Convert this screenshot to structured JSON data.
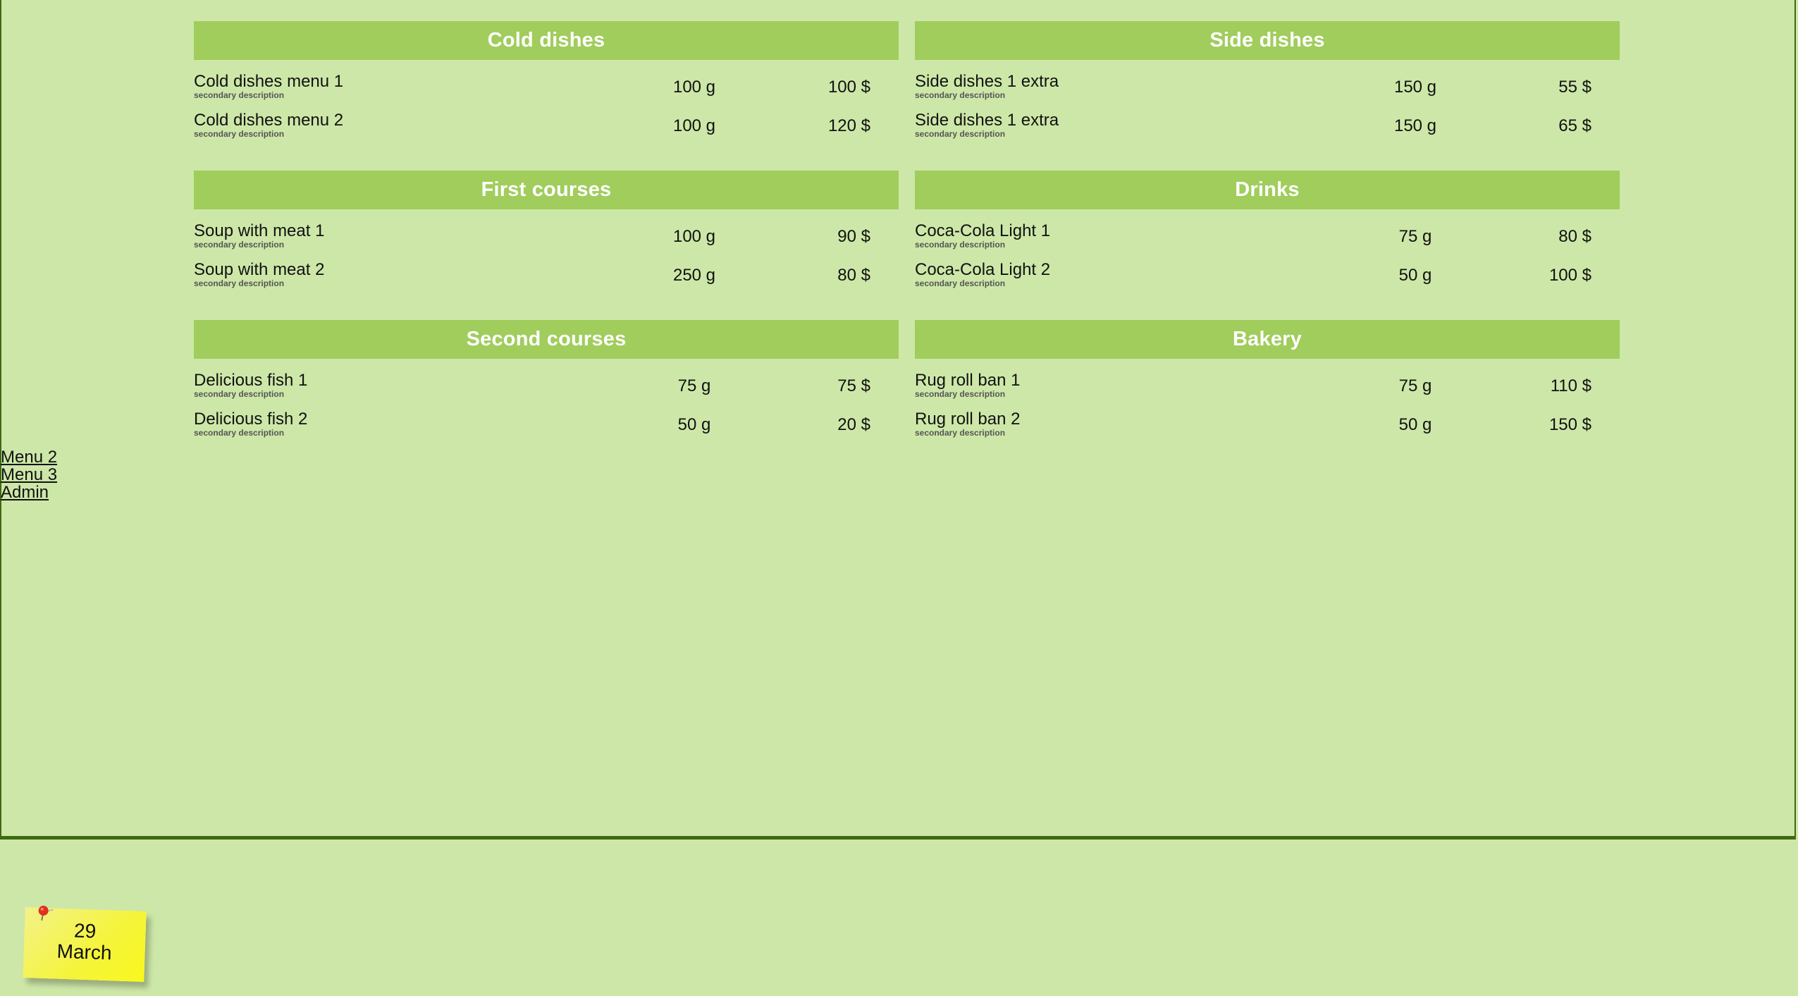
{
  "sections": [
    {
      "title": "Cold dishes",
      "items": [
        {
          "name": "Cold dishes menu 1",
          "desc": "secondary description",
          "weight": "100 g",
          "price": "100 $"
        },
        {
          "name": "Cold dishes menu 2",
          "desc": "secondary description",
          "weight": "100 g",
          "price": "120 $"
        }
      ]
    },
    {
      "title": "Side dishes",
      "items": [
        {
          "name": "Side dishes 1 extra",
          "desc": "secondary description",
          "weight": "150 g",
          "price": "55 $"
        },
        {
          "name": "Side dishes 1 extra",
          "desc": "secondary description",
          "weight": "150 g",
          "price": "65 $"
        }
      ]
    },
    {
      "title": "First courses",
      "items": [
        {
          "name": "Soup with meat 1",
          "desc": "secondary description",
          "weight": "100 g",
          "price": "90 $"
        },
        {
          "name": "Soup with meat 2",
          "desc": "secondary description",
          "weight": "250 g",
          "price": "80 $"
        }
      ]
    },
    {
      "title": "Drinks",
      "items": [
        {
          "name": "Coca-Cola Light 1",
          "desc": "secondary description",
          "weight": "75 g",
          "price": "80 $"
        },
        {
          "name": "Coca-Cola Light 2",
          "desc": "secondary description",
          "weight": "50 g",
          "price": "100 $"
        }
      ]
    },
    {
      "title": "Second courses",
      "items": [
        {
          "name": "Delicious fish 1",
          "desc": "secondary description",
          "weight": "75 g",
          "price": "75 $"
        },
        {
          "name": "Delicious fish 2",
          "desc": "secondary description",
          "weight": "50 g",
          "price": "20 $"
        }
      ]
    },
    {
      "title": "Bakery",
      "items": [
        {
          "name": "Rug roll ban 1",
          "desc": "secondary description",
          "weight": "75 g",
          "price": "110 $"
        },
        {
          "name": "Rug roll ban 2",
          "desc": "secondary description",
          "weight": "50 g",
          "price": "150 $"
        }
      ]
    }
  ],
  "nav": {
    "links": [
      "Menu 2",
      "Menu 3",
      "Admin"
    ]
  },
  "date_note": {
    "day": "29",
    "month": "March",
    "icon": "pin-icon"
  },
  "colors": {
    "background": "#cde7a8",
    "header": "#a0cd5c",
    "border": "#3f6a10",
    "note": "#f5f43a"
  }
}
